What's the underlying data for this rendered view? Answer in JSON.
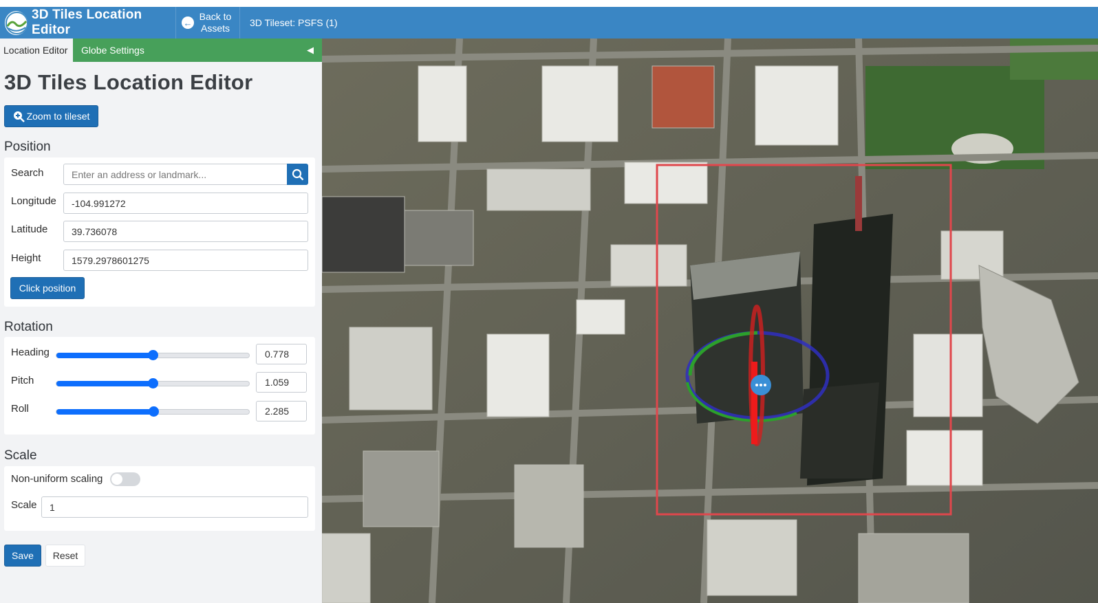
{
  "app": {
    "title": "3D Tiles Location Editor",
    "back_label": "Back to Assets",
    "tileset_name": "3D Tileset: PSFS (1)"
  },
  "tabs": [
    "Location Editor",
    "Globe Settings"
  ],
  "panel": {
    "title": "3D Tiles Location Editor",
    "zoom_button": "Zoom to tileset",
    "position": {
      "heading": "Position",
      "search_label": "Search",
      "search_placeholder": "Enter an address or landmark...",
      "longitude_label": "Longitude",
      "longitude": "-104.991272",
      "latitude_label": "Latitude",
      "latitude": "39.736078",
      "height_label": "Height",
      "height": "1579.2978601275",
      "click_button": "Click position"
    },
    "rotation": {
      "heading": "Rotation",
      "items": [
        {
          "label": "Heading",
          "value": "0.778",
          "fraction": 0.5
        },
        {
          "label": "Pitch",
          "value": "1.059",
          "fraction": 0.5
        },
        {
          "label": "Roll",
          "value": "2.285",
          "fraction": 0.505
        }
      ]
    },
    "scale": {
      "heading": "Scale",
      "nonuniform_label": "Non-uniform scaling",
      "nonuniform_enabled": false,
      "scale_label": "Scale",
      "scale_value": "1"
    },
    "save_button": "Save",
    "reset_button": "Reset"
  },
  "colors": {
    "topbar": "#3a86c4",
    "tab_bar": "#47a05a",
    "primary": "#1f6fb5",
    "selection_box": "#e0474c"
  },
  "icons": {
    "logo": "globe-logo-icon",
    "back": "arrow-left-circle-icon",
    "zoom": "zoom-in-icon",
    "search": "search-icon",
    "collapse": "caret-left-icon"
  }
}
